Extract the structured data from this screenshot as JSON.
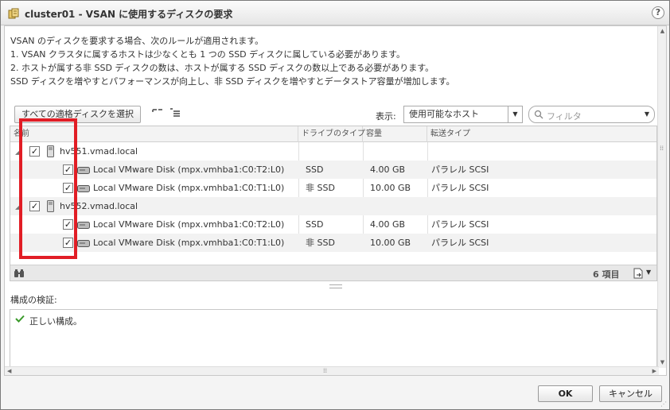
{
  "dialog": {
    "title": "cluster01 - VSAN に使用するディスクの要求",
    "help_icon": "?"
  },
  "rules": [
    "VSAN のディスクを要求する場合、次のルールが適用されます。",
    "1. VSAN クラスタに属するホストは少なくとも 1 つの SSD ディスクに属している必要があります。",
    "2. ホストが属する非 SSD ディスクの数は、ホストが属する SSD ディスクの数以上である必要があります。",
    "SSD ディスクを増やすとパフォーマンスが向上し、非 SSD ディスクを増やすとデータストア容量が増加します。"
  ],
  "toolbar": {
    "select_all_label": "すべての適格ディスクを選択",
    "show_label": "表示:",
    "show_value": "使用可能なホスト",
    "filter_placeholder": "フィルタ"
  },
  "grid": {
    "columns": [
      "名前",
      "ドライブのタイプ",
      "容量",
      "転送タイプ"
    ],
    "rows": [
      {
        "type": "host",
        "name": "hv551.vmad.local",
        "checked": true
      },
      {
        "type": "disk",
        "name": "Local VMware Disk (mpx.vmhba1:C0:T2:L0)",
        "drive": "SSD",
        "capacity": "4.00 GB",
        "transport": "パラレル SCSI",
        "checked": true
      },
      {
        "type": "disk",
        "name": "Local VMware Disk (mpx.vmhba1:C0:T1:L0)",
        "drive": "非 SSD",
        "capacity": "10.00 GB",
        "transport": "パラレル SCSI",
        "checked": true
      },
      {
        "type": "host",
        "name": "hv552.vmad.local",
        "checked": true
      },
      {
        "type": "disk",
        "name": "Local VMware Disk (mpx.vmhba1:C0:T2:L0)",
        "drive": "SSD",
        "capacity": "4.00 GB",
        "transport": "パラレル SCSI",
        "checked": true
      },
      {
        "type": "disk",
        "name": "Local VMware Disk (mpx.vmhba1:C0:T1:L0)",
        "drive": "非 SSD",
        "capacity": "10.00 GB",
        "transport": "パラレル SCSI",
        "checked": true
      }
    ],
    "item_count": "6 項目"
  },
  "validation": {
    "label": "構成の検証:",
    "message": "正しい構成。"
  },
  "buttons": {
    "ok": "OK",
    "cancel": "キャンセル"
  },
  "colors": {
    "highlight": "#e11d25",
    "check_green": "#3a9a2a"
  }
}
